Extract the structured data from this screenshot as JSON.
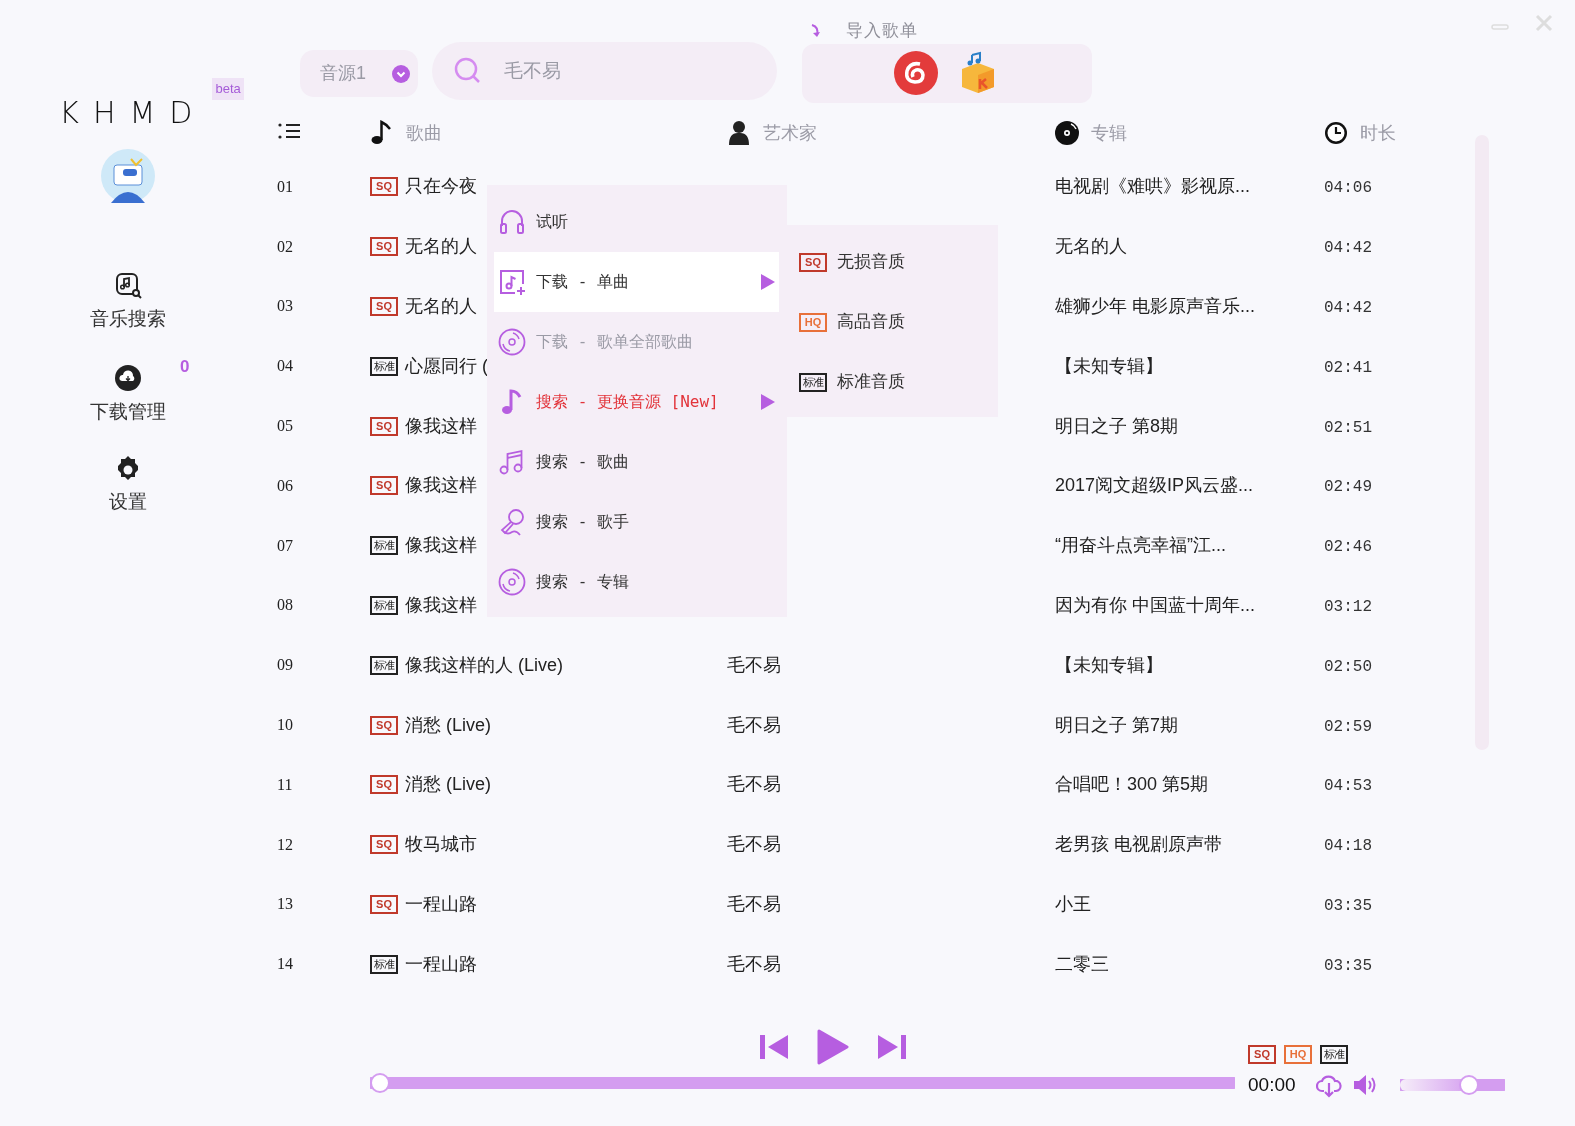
{
  "app": {
    "logo": "KHMD",
    "tag": "beta"
  },
  "sidebar": {
    "items": [
      {
        "label": "音乐搜索",
        "kind": "search"
      },
      {
        "label": "下载管理",
        "kind": "download",
        "count": "0"
      },
      {
        "label": "设置",
        "kind": "settings"
      }
    ]
  },
  "toolbar": {
    "source_select": {
      "value": "音源1"
    },
    "search": {
      "value": "毛不易"
    },
    "import": {
      "label": "导入歌单",
      "sources": [
        {
          "kind": "netease"
        },
        {
          "kind": "kugou"
        }
      ]
    }
  },
  "table": {
    "columns": [
      {
        "kind": "index"
      },
      {
        "label": "歌曲",
        "kind": "song"
      },
      {
        "label": "艺术家",
        "kind": "artist"
      },
      {
        "label": "专辑",
        "kind": "album"
      },
      {
        "label": "时长",
        "kind": "time"
      }
    ],
    "rows": [
      {
        "index": "01",
        "badge": {
          "kind": "sq",
          "text": "SQ"
        },
        "title": "只在今夜",
        "album": "电视剧《难哄》影视原...",
        "duration": "04:06"
      },
      {
        "index": "02",
        "badge": {
          "kind": "sq",
          "text": "SQ"
        },
        "title": "无名的人",
        "album": "无名的人",
        "duration": "04:42"
      },
      {
        "index": "03",
        "badge": {
          "kind": "sq",
          "text": "SQ"
        },
        "title": "无名的人",
        "album": "雄狮少年 电影原声音乐...",
        "duration": "04:42"
      },
      {
        "index": "04",
        "badge": {
          "kind": "std",
          "text": "标准"
        },
        "title": "心愿同行 (",
        "album": "【未知专辑】",
        "duration": "02:41"
      },
      {
        "index": "05",
        "badge": {
          "kind": "sq",
          "text": "SQ"
        },
        "title": "像我这样",
        "album": "明日之子 第8期",
        "duration": "02:51"
      },
      {
        "index": "06",
        "badge": {
          "kind": "sq",
          "text": "SQ"
        },
        "title": "像我这样",
        "album": "2017阅文超级IP风云盛...",
        "duration": "02:49"
      },
      {
        "index": "07",
        "badge": {
          "kind": "std",
          "text": "标准"
        },
        "title": "像我这样",
        "album": "“用奋斗点亮幸福”江...",
        "duration": "02:46"
      },
      {
        "index": "08",
        "badge": {
          "kind": "std",
          "text": "标准"
        },
        "title": "像我这样",
        "album": "因为有你 中国蓝十周年...",
        "duration": "03:12"
      },
      {
        "index": "09",
        "badge": {
          "kind": "std",
          "text": "标准"
        },
        "title": "像我这样的人 (Live)",
        "artist": "毛不易",
        "album": "【未知专辑】",
        "duration": "02:50"
      },
      {
        "index": "10",
        "badge": {
          "kind": "sq",
          "text": "SQ"
        },
        "title": "消愁 (Live)",
        "artist": "毛不易",
        "album": "明日之子 第7期",
        "duration": "02:59"
      },
      {
        "index": "11",
        "badge": {
          "kind": "sq",
          "text": "SQ"
        },
        "title": "消愁 (Live)",
        "artist": "毛不易",
        "album": "合唱吧！300 第5期",
        "duration": "04:53"
      },
      {
        "index": "12",
        "badge": {
          "kind": "sq",
          "text": "SQ"
        },
        "title": "牧马城市",
        "artist": "毛不易",
        "album": "老男孩 电视剧原声带",
        "duration": "04:18"
      },
      {
        "index": "13",
        "badge": {
          "kind": "sq",
          "text": "SQ"
        },
        "title": "一程山路",
        "artist": "毛不易",
        "album": "小王",
        "duration": "03:35"
      },
      {
        "index": "14",
        "badge": {
          "kind": "std",
          "text": "标准"
        },
        "title": "一程山路",
        "artist": "毛不易",
        "album": "二零三",
        "duration": "03:35"
      }
    ]
  },
  "context_menu": {
    "items": [
      {
        "label": "试听",
        "kind": "headphones",
        "selected": false,
        "disabled": false,
        "emphasized": false,
        "submenu": false
      },
      {
        "label": "下载 - 单曲",
        "kind": "music-add",
        "selected": true,
        "disabled": false,
        "emphasized": false,
        "submenu": true
      },
      {
        "label": "下载 - 歌单全部歌曲",
        "kind": "disc",
        "selected": false,
        "disabled": true,
        "emphasized": false,
        "submenu": false
      },
      {
        "label": "搜索 - 更换音源 [New]",
        "kind": "note",
        "selected": false,
        "disabled": false,
        "emphasized": true,
        "submenu": true
      },
      {
        "label": "搜索 - 歌曲",
        "kind": "notes",
        "selected": false,
        "disabled": false,
        "emphasized": false,
        "submenu": false
      },
      {
        "label": "搜索 - 歌手",
        "kind": "mic",
        "selected": false,
        "disabled": false,
        "emphasized": false,
        "submenu": false
      },
      {
        "label": "搜索 - 专辑",
        "kind": "disc",
        "selected": false,
        "disabled": false,
        "emphasized": false,
        "submenu": false
      }
    ],
    "submenu": [
      {
        "badge": {
          "kind": "sq",
          "text": "SQ"
        },
        "label": "无损音质"
      },
      {
        "badge": {
          "kind": "hq",
          "text": "HQ"
        },
        "label": "高品音质"
      },
      {
        "badge": {
          "kind": "std",
          "text": "标准"
        },
        "label": "标准音质"
      }
    ]
  },
  "player": {
    "quality_badges": [
      {
        "kind": "sq",
        "text": "SQ"
      },
      {
        "kind": "hq",
        "text": "HQ"
      },
      {
        "kind": "std",
        "text": "标准"
      }
    ],
    "progress": {
      "level": 0
    },
    "time": "00:00",
    "volume": {
      "level": 0.7
    }
  }
}
